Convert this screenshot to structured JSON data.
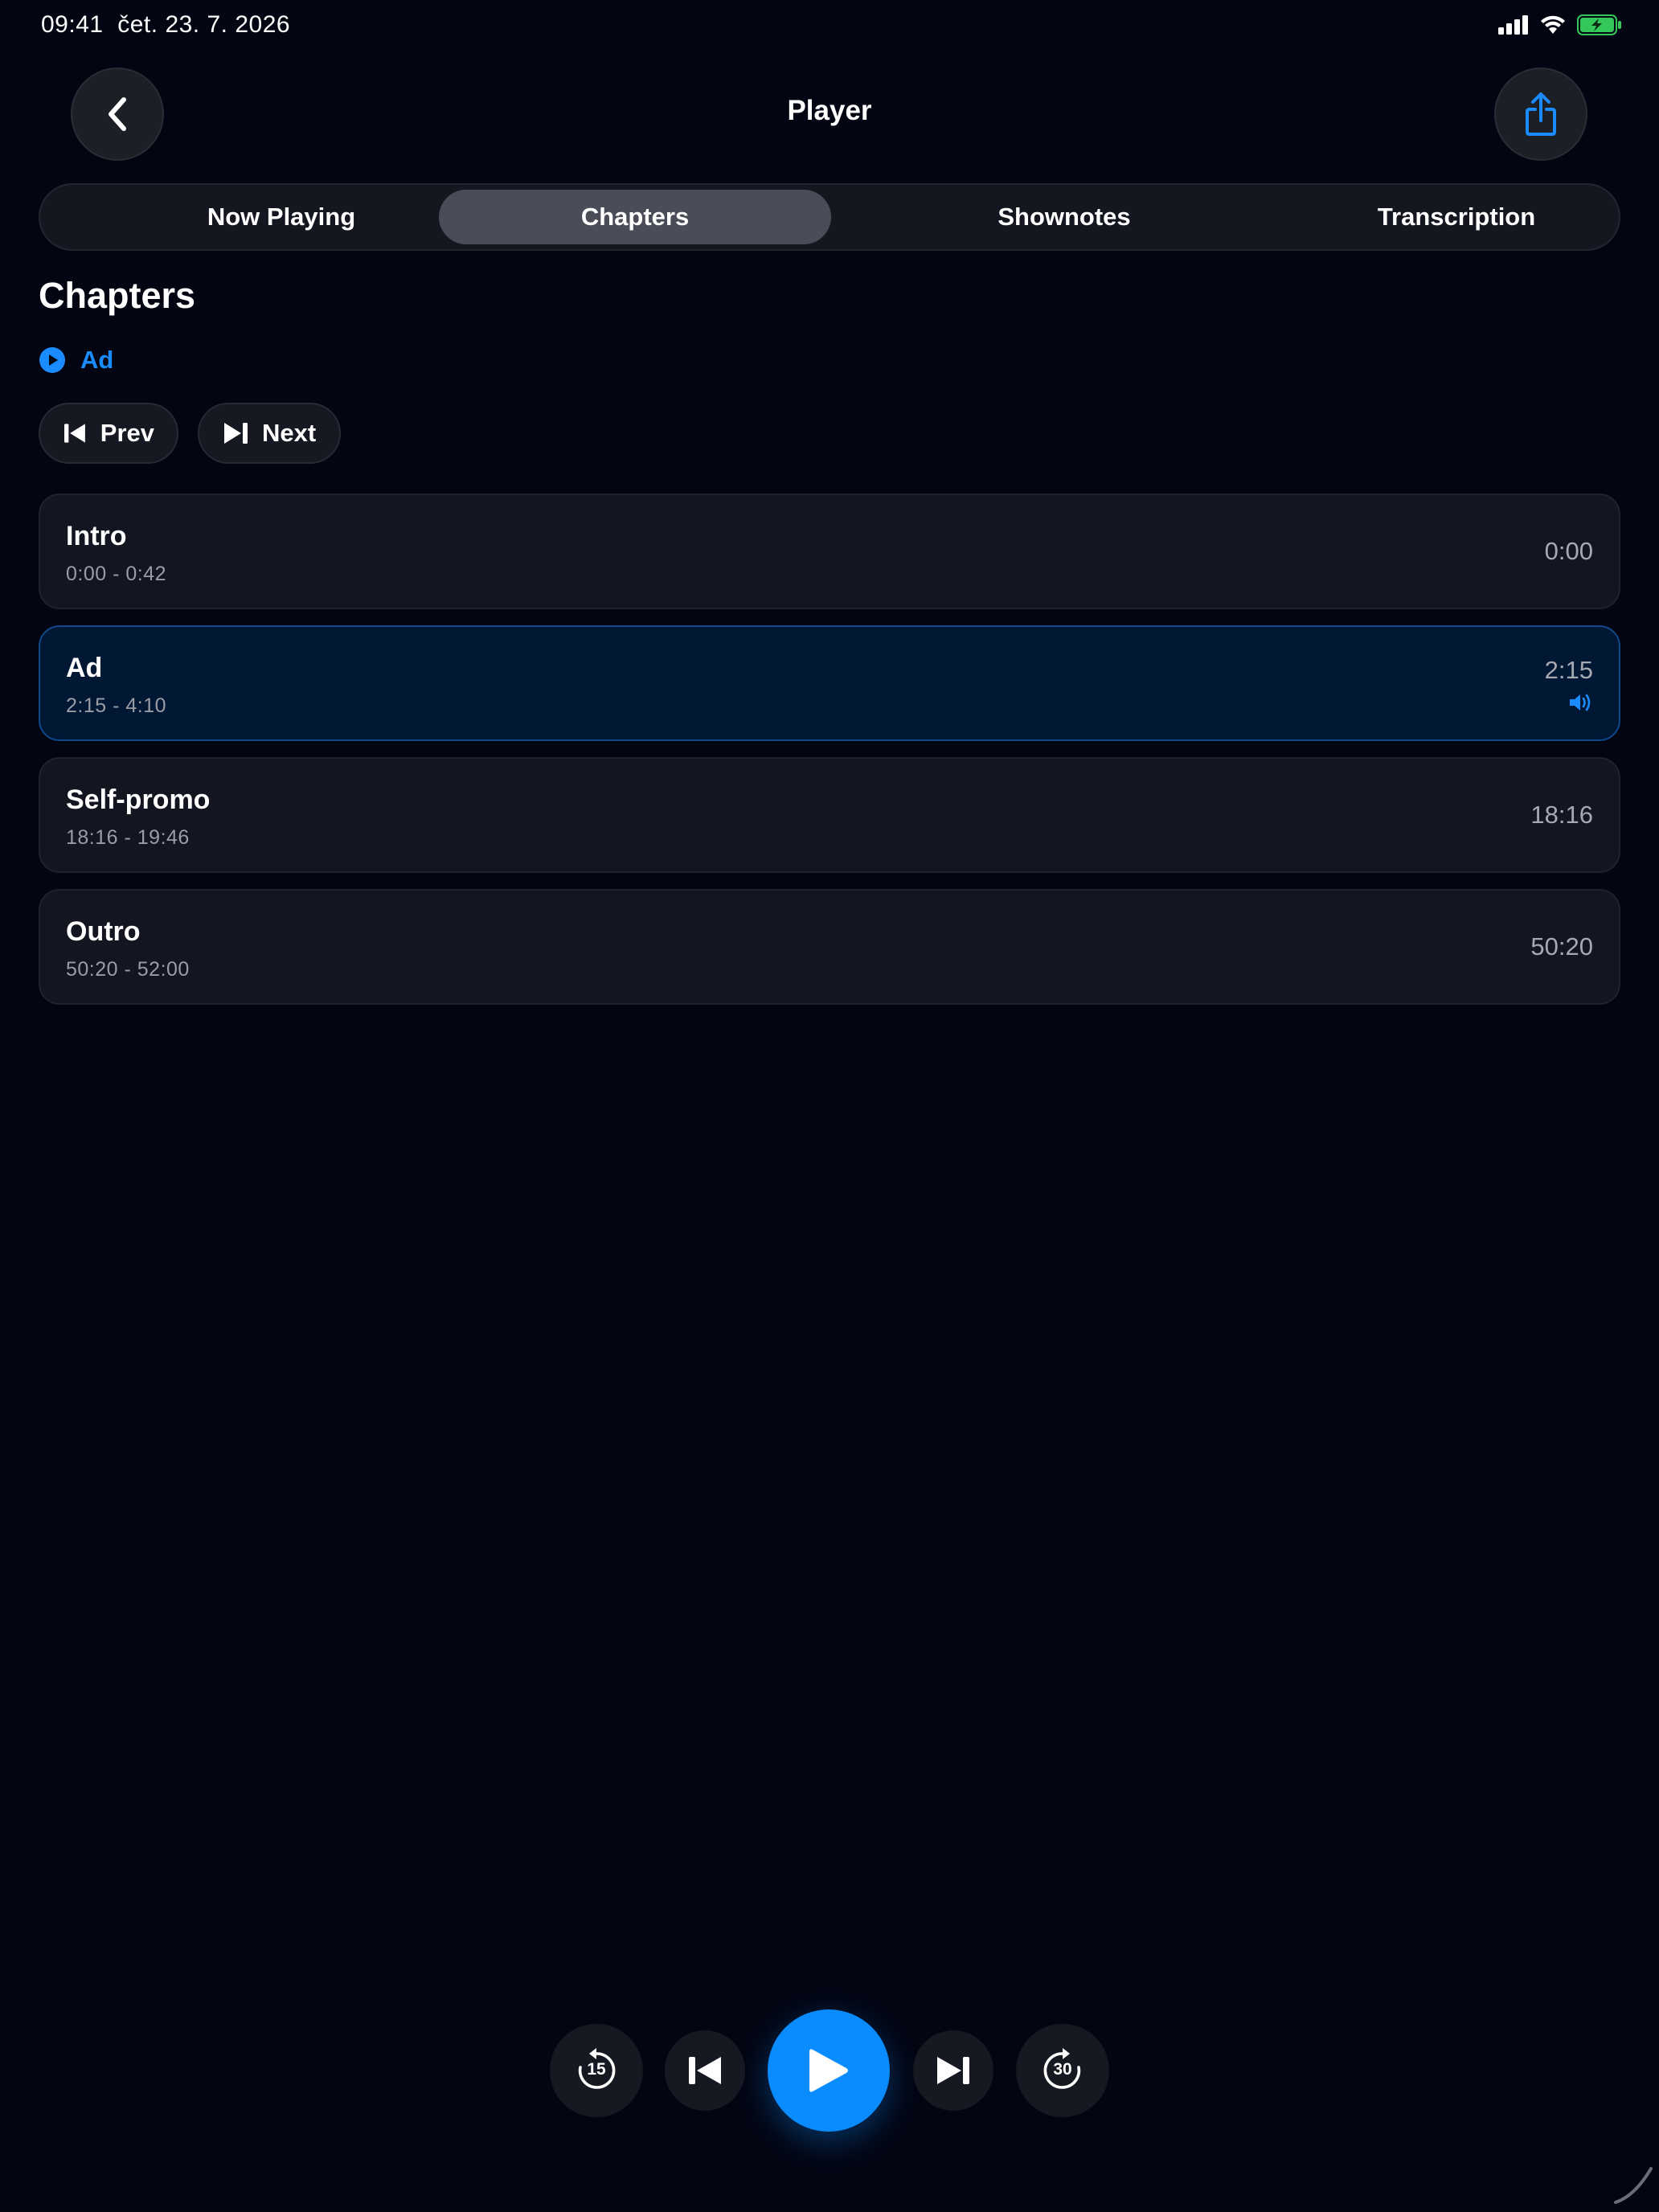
{
  "status_bar": {
    "time": "09:41",
    "date": "čet. 23. 7. 2026",
    "icons": [
      "cellular-signal-icon",
      "wifi-icon",
      "battery-charging-icon"
    ],
    "battery_color": "#34c759"
  },
  "header": {
    "title": "Player",
    "back_icon": "chevron-left-icon",
    "share_icon": "share-icon"
  },
  "tabs": [
    {
      "label": "Now Playing",
      "active": false
    },
    {
      "label": "Chapters",
      "active": true
    },
    {
      "label": "Shownotes",
      "active": false
    },
    {
      "label": "Transcription",
      "active": false
    }
  ],
  "chapters_section": {
    "heading": "Chapters",
    "current_chapter": "Ad",
    "prev_label": "Prev",
    "next_label": "Next"
  },
  "chapters": [
    {
      "title": "Intro",
      "range": "0:00 - 0:42",
      "start": "0:00",
      "active": false
    },
    {
      "title": "Ad",
      "range": "2:15 - 4:10",
      "start": "2:15",
      "active": true
    },
    {
      "title": "Self-promo",
      "range": "18:16 - 19:46",
      "start": "18:16",
      "active": false
    },
    {
      "title": "Outro",
      "range": "50:20 - 52:00",
      "start": "50:20",
      "active": false
    }
  ],
  "controls": {
    "skip_back_seconds": "15",
    "skip_forward_seconds": "30"
  },
  "colors": {
    "accent": "#0a8cff",
    "background": "#030512",
    "active_row": "#011835"
  }
}
